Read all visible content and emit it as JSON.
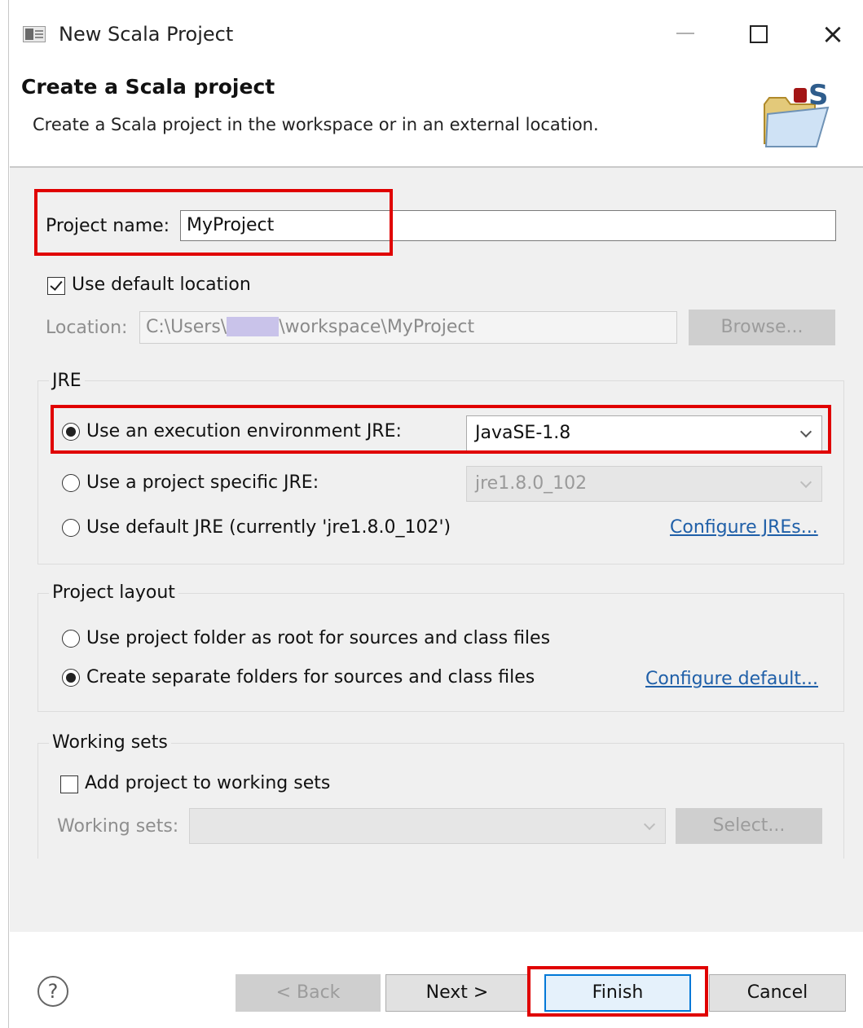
{
  "window": {
    "title": "New Scala Project",
    "icons": [
      "app-icon",
      "minimize-icon",
      "maximize-icon",
      "close-icon"
    ],
    "close_glyph": "×"
  },
  "header": {
    "title": "Create a Scala project",
    "description": "Create a Scala project in the workspace or in an external location.",
    "logo_text": "S"
  },
  "project": {
    "name_label": "Project name:",
    "name_value": "MyProject"
  },
  "location": {
    "use_default_label": "Use default location",
    "use_default_checked": true,
    "label": "Location:",
    "path_start": "C:\\Users\\",
    "path_end": "\\workspace\\MyProject",
    "browse_label": "Browse..."
  },
  "jre": {
    "group_title": "JRE",
    "options": [
      {
        "label": "Use an execution environment JRE:",
        "selected": true
      },
      {
        "label": "Use a project specific JRE:",
        "selected": false
      },
      {
        "label": "Use default JRE (currently 'jre1.8.0_102')",
        "selected": false
      }
    ],
    "execution_env_value": "JavaSE-1.8",
    "project_jre_value": "jre1.8.0_102",
    "configure_link": "Configure JREs..."
  },
  "layout": {
    "group_title": "Project layout",
    "options": [
      {
        "label": "Use project folder as root for sources and class files",
        "selected": false
      },
      {
        "label": "Create separate folders for sources and class files",
        "selected": true
      }
    ],
    "configure_link": "Configure default..."
  },
  "working_sets": {
    "group_title": "Working sets",
    "add_label": "Add project to working sets",
    "add_checked": false,
    "label": "Working sets:",
    "value": "",
    "select_label": "Select..."
  },
  "buttons": {
    "help": "?",
    "back": "< Back",
    "next": "Next >",
    "finish": "Finish",
    "cancel": "Cancel"
  },
  "colors": {
    "highlight": "#e00000",
    "link": "#1f5fa8",
    "default_button_border": "#0078d7"
  }
}
